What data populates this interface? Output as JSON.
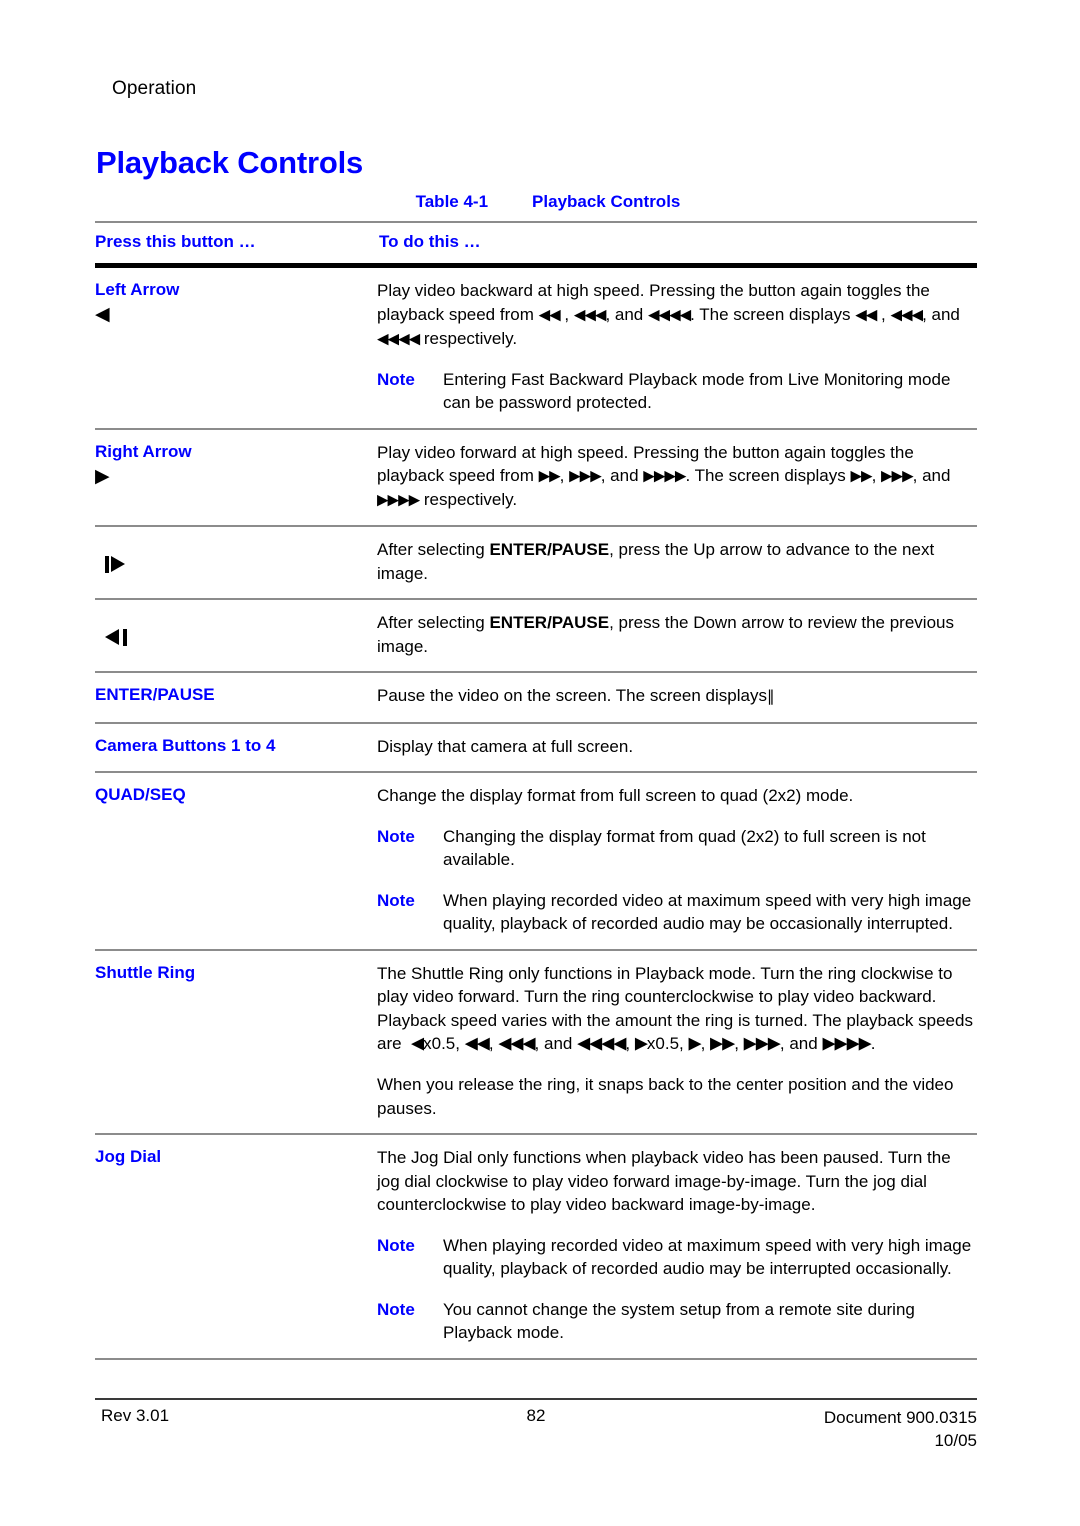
{
  "header": {
    "running_head": "Operation",
    "title": "Playback Controls"
  },
  "table": {
    "caption_number": "Table 4-1",
    "caption_title": "Playback Controls",
    "columns": [
      "Press this button …",
      "To do this …"
    ],
    "rows": [
      {
        "button_label": "Left Arrow",
        "button_icon": "left-arrow-glyph",
        "paragraphs": [
          "Play video backward at high speed. Pressing the button again toggles the playback speed from ◀◀ , ◀◀◀, and ◀◀◀◀. The screen displays ◀◀ , ◀◀◀, and ◀◀◀◀ respectively."
        ],
        "notes": [
          {
            "tag": "Note",
            "text": "Entering Fast Backward Playback mode from Live Monitoring mode can be password protected."
          }
        ]
      },
      {
        "button_label": "Right Arrow",
        "button_icon": "right-arrow-glyph",
        "paragraphs": [
          "Play video forward at high speed. Pressing the button again toggles the playback speed from ▶▶, ▶▶▶, and ▶▶▶▶. The screen displays ▶▶, ▶▶▶, and ▶▶▶▶ respectively."
        ],
        "notes": []
      },
      {
        "button_label": "",
        "button_icon": "step-forward-icon",
        "paragraphs": [
          "After selecting ENTER/PAUSE, press the Up arrow to advance to the next image."
        ],
        "notes": []
      },
      {
        "button_label": "",
        "button_icon": "step-backward-icon",
        "paragraphs": [
          "After selecting ENTER/PAUSE, press the Down arrow to review the previous image."
        ],
        "notes": []
      },
      {
        "button_label": "ENTER/PAUSE",
        "button_icon": "",
        "paragraphs": [
          "Pause the video on the screen. The screen displays ‖"
        ],
        "notes": []
      },
      {
        "button_label": "Camera Buttons 1 to 4",
        "button_icon": "",
        "paragraphs": [
          "Display that camera at full screen."
        ],
        "notes": []
      },
      {
        "button_label": "QUAD/SEQ",
        "button_icon": "",
        "paragraphs": [
          "Change the display format from full screen to quad (2x2) mode."
        ],
        "notes": [
          {
            "tag": "Note",
            "text": "Changing the display format from quad (2x2) to full screen is not available."
          },
          {
            "tag": "Note",
            "text": "When playing recorded video at maximum speed with very high image quality, playback of recorded audio may be occasionally interrupted."
          }
        ]
      },
      {
        "button_label": "Shuttle Ring",
        "button_icon": "",
        "paragraphs": [
          "The Shuttle Ring only functions in Playback mode. Turn the ring clockwise to play video forward. Turn the ring counterclockwise to play video backward. Playback speed varies with the amount the ring is turned. The playback speeds are  ◀x0.5, ◀◀, ◀◀◀, and ◀◀◀◀, ▶x0.5, ▶, ▶▶, ▶▶▶, and ▶▶▶▶.",
          "When you release the ring, it snaps back to the center position and the video pauses."
        ],
        "notes": []
      },
      {
        "button_label": "Jog Dial",
        "button_icon": "",
        "paragraphs": [
          "The Jog Dial only functions when playback video has been paused. Turn the jog dial clockwise to play video forward image-by-image. Turn the jog dial counterclockwise to play video backward image-by-image."
        ],
        "notes": [
          {
            "tag": "Note",
            "text": "When playing recorded video at maximum speed with very high image quality, playback of recorded audio may be interrupted occasionally."
          },
          {
            "tag": "Note",
            "text": "You cannot change the system setup from a remote site during Playback mode."
          }
        ]
      }
    ]
  },
  "footer": {
    "revision": "Rev 3.01",
    "page_number": "82",
    "document_id": "Document 900.0315",
    "date": "10/05"
  },
  "colors": {
    "accent_blue": "#0000ff",
    "rule_gray": "#8c8c8c",
    "rule_black": "#000000"
  }
}
